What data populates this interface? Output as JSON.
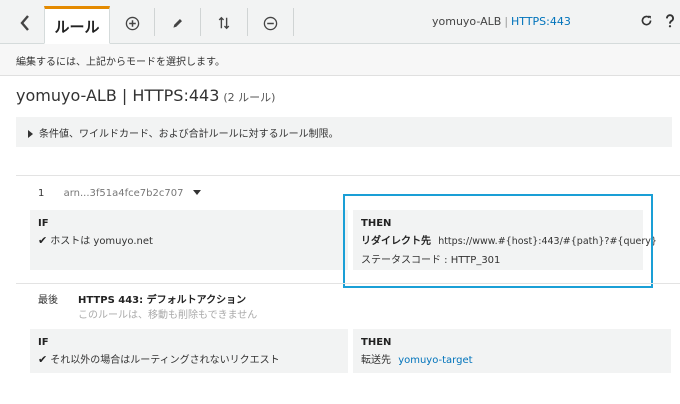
{
  "toolbar": {
    "back_icon": "chevron-left-icon",
    "tab_label": "ルール",
    "add_icon": "plus-circle-icon",
    "edit_icon": "pencil-icon",
    "reorder_icon": "sort-arrows-icon",
    "delete_icon": "minus-circle-icon",
    "lb_name": "yomuyo-ALB",
    "separator": "|",
    "listener": "HTTPS:443",
    "refresh_icon": "refresh-icon",
    "help_icon": "help-icon"
  },
  "hint": "編集するには、上記からモードを選択します。",
  "page": {
    "title": "yomuyo-ALB | HTTPS:443",
    "rule_count": "(2 ルール)"
  },
  "limits_text": "条件値、ワイルドカード、および合計ルールに対するルール制限。",
  "rule1": {
    "number": "1",
    "arn": "arn...3f51a4fce7b2c707",
    "if_label": "IF",
    "condition": "ホストは yomuyo.net",
    "then_label": "THEN",
    "action_label": "リダイレクト先",
    "redirect_url": "https://www.#{host}:443/#{path}?#{query}",
    "status_code": "ステータスコード : HTTP_301"
  },
  "rule_default": {
    "position": "最後",
    "title": "HTTPS 443: デフォルトアクション",
    "note": "このルールは、移動も削除もできません",
    "if_label": "IF",
    "condition": "それ以外の場合はルーティングされないリクエスト",
    "then_label": "THEN",
    "forward_label": "転送先",
    "target": "yomuyo-target"
  },
  "colors": {
    "accent": "#e48a00",
    "link": "#0073bb",
    "highlight": "#1a9fd6"
  }
}
